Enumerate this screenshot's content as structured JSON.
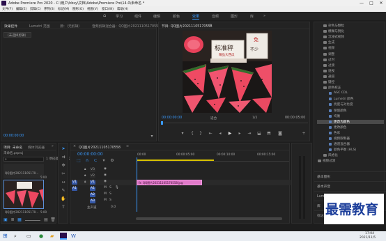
{
  "window": {
    "title": "Adobe Premiere Pro 2020 - C:\\用户\\hbsy\\文档\\Adobe\\Premiere Pro\\14.0\\未命名 *",
    "minimize": "—",
    "maximize": "□",
    "close": "✕"
  },
  "menu": [
    "文件(F)",
    "编辑(E)",
    "剪辑(C)",
    "序列(S)",
    "标记(M)",
    "图形(G)",
    "视图(V)",
    "窗口(W)",
    "帮助(H)"
  ],
  "workspaces": {
    "home": "⌂",
    "tabs": [
      "学习",
      "组件",
      "编辑",
      "颜色",
      "效果",
      "音频",
      "图形",
      "库"
    ],
    "active": "效果",
    "more": "»"
  },
  "effect_controls": {
    "tabs": [
      "效果控件",
      "Lumetri 范围",
      "源：（无剪辑）",
      "音频剪辑混合器：QQ图片20211105170557"
    ],
    "active": "效果控件",
    "no_clip_message": "（未选择剪辑）",
    "timecode": "00:00:00:00"
  },
  "program_monitor": {
    "title": "节目: QQ图片20211105170558",
    "menu_icon": "≡",
    "image_signs": [
      "标准秤",
      "免",
      "不少",
      "精品大西瓜"
    ],
    "timecode_left": "00:00:00:00",
    "fit": "适合",
    "ratio": "1/2",
    "timecode_right": "00:00:05:00"
  },
  "project": {
    "tabs": [
      "项目: 未命名",
      "媒体浏览器"
    ],
    "more": "»",
    "file_name": "未命名.prproj",
    "count": "1 项已选择，共 2 项",
    "search_placeholder": "",
    "thumbs": [
      {
        "name": "QQ图片20211105170...",
        "duration": "5:00"
      },
      {
        "name": "QQ图片20211105170...",
        "duration": "5:00"
      }
    ]
  },
  "timeline": {
    "title": "QQ图片20211105170558",
    "close": "×",
    "menu_icon": "≡",
    "timecode": "00:00:00:00",
    "ruler": [
      "00:00",
      "00:00:05:00",
      "00:00:10:00",
      "00:00:15:00"
    ],
    "tracks": [
      "V3",
      "V2",
      "V1",
      "A1",
      "A2",
      "A3",
      "主声道"
    ],
    "master_value": "0.0",
    "clip_label": "QQ图片20211105170558.jpg",
    "clip_fx": "fx"
  },
  "effects_panel": {
    "items": [
      {
        "label": "杂色与颗粒",
        "depth": 1,
        "type": "folder"
      },
      {
        "label": "模糊与锐化",
        "depth": 1,
        "type": "folder"
      },
      {
        "label": "沉浸式视频",
        "depth": 1,
        "type": "folder"
      },
      {
        "label": "生成",
        "depth": 1,
        "type": "folder"
      },
      {
        "label": "视频",
        "depth": 1,
        "type": "folder"
      },
      {
        "label": "调整",
        "depth": 1,
        "type": "folder"
      },
      {
        "label": "过时",
        "depth": 1,
        "type": "folder"
      },
      {
        "label": "过渡",
        "depth": 1,
        "type": "folder"
      },
      {
        "label": "透视",
        "depth": 1,
        "type": "folder"
      },
      {
        "label": "通道",
        "depth": 1,
        "type": "folder"
      },
      {
        "label": "键控",
        "depth": 1,
        "type": "folder"
      },
      {
        "label": "颜色校正",
        "depth": 1,
        "type": "folder-open"
      },
      {
        "label": "ASC CDL",
        "depth": 2,
        "type": "effect"
      },
      {
        "label": "Lumetri 颜色",
        "depth": 2,
        "type": "effect"
      },
      {
        "label": "亮度与对比度",
        "depth": 2,
        "type": "effect"
      },
      {
        "label": "保留颜色",
        "depth": 2,
        "type": "effect"
      },
      {
        "label": "均衡",
        "depth": 2,
        "type": "effect"
      },
      {
        "label": "更改为颜色",
        "depth": 2,
        "type": "effect",
        "selected": true
      },
      {
        "label": "更改颜色",
        "depth": 2,
        "type": "effect"
      },
      {
        "label": "色彩",
        "depth": 2,
        "type": "effect"
      },
      {
        "label": "视频限制器",
        "depth": 2,
        "type": "effect"
      },
      {
        "label": "通道混合器",
        "depth": 2,
        "type": "effect"
      },
      {
        "label": "颜色平衡 (HLS)",
        "depth": 2,
        "type": "effect"
      },
      {
        "label": "风格化",
        "depth": 1,
        "type": "folder"
      },
      {
        "label": "视频过渡",
        "depth": 0,
        "type": "folder"
      }
    ],
    "sections": [
      "基本图形",
      "基本声音",
      "Lumetri 颜色",
      "库",
      "标记"
    ]
  },
  "taskbar": {
    "time": "17:04",
    "date": "2021/11/5",
    "watermark": "最需教育"
  }
}
